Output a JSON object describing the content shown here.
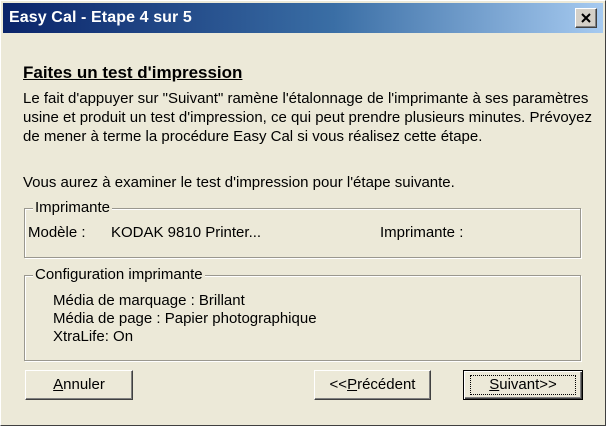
{
  "window": {
    "title": "Easy Cal - Etape 4 sur 5"
  },
  "content": {
    "heading": "Faites un test d'impression",
    "paragraph1": "Le fait d'appuyer sur \"Suivant\" ramène l'étalonnage de l'imprimante à ses paramètres usine et produit un test d'impression, ce qui peut prendre plusieurs minutes. Prévoyez de mener à terme la procédure Easy Cal si vous réalisez cette étape.",
    "paragraph2": "Vous aurez à examiner le test d'impression pour l'étape suivante."
  },
  "printer_group": {
    "legend": "Imprimante",
    "model_label": "Modèle :",
    "model_value": "KODAK 9810 Printer...",
    "printer_label": "Imprimante :",
    "printer_value": ""
  },
  "config_group": {
    "legend": "Configuration imprimante",
    "lines": [
      "Média de marquage : Brillant",
      "Média de page : Papier photographique",
      "XtraLife: On"
    ]
  },
  "buttons": {
    "cancel": {
      "before": "",
      "mnemonic": "A",
      "after": "nnuler"
    },
    "previous": {
      "before": "<<",
      "mnemonic": "P",
      "after": "récédent"
    },
    "next": {
      "before": "",
      "mnemonic": "S",
      "after": "uivant>>"
    }
  },
  "icons": {
    "close": "close-icon"
  },
  "colors": {
    "titlebar_start": "#0a246a",
    "titlebar_end": "#a6caf0",
    "dialog_background": "#ece9d8"
  }
}
